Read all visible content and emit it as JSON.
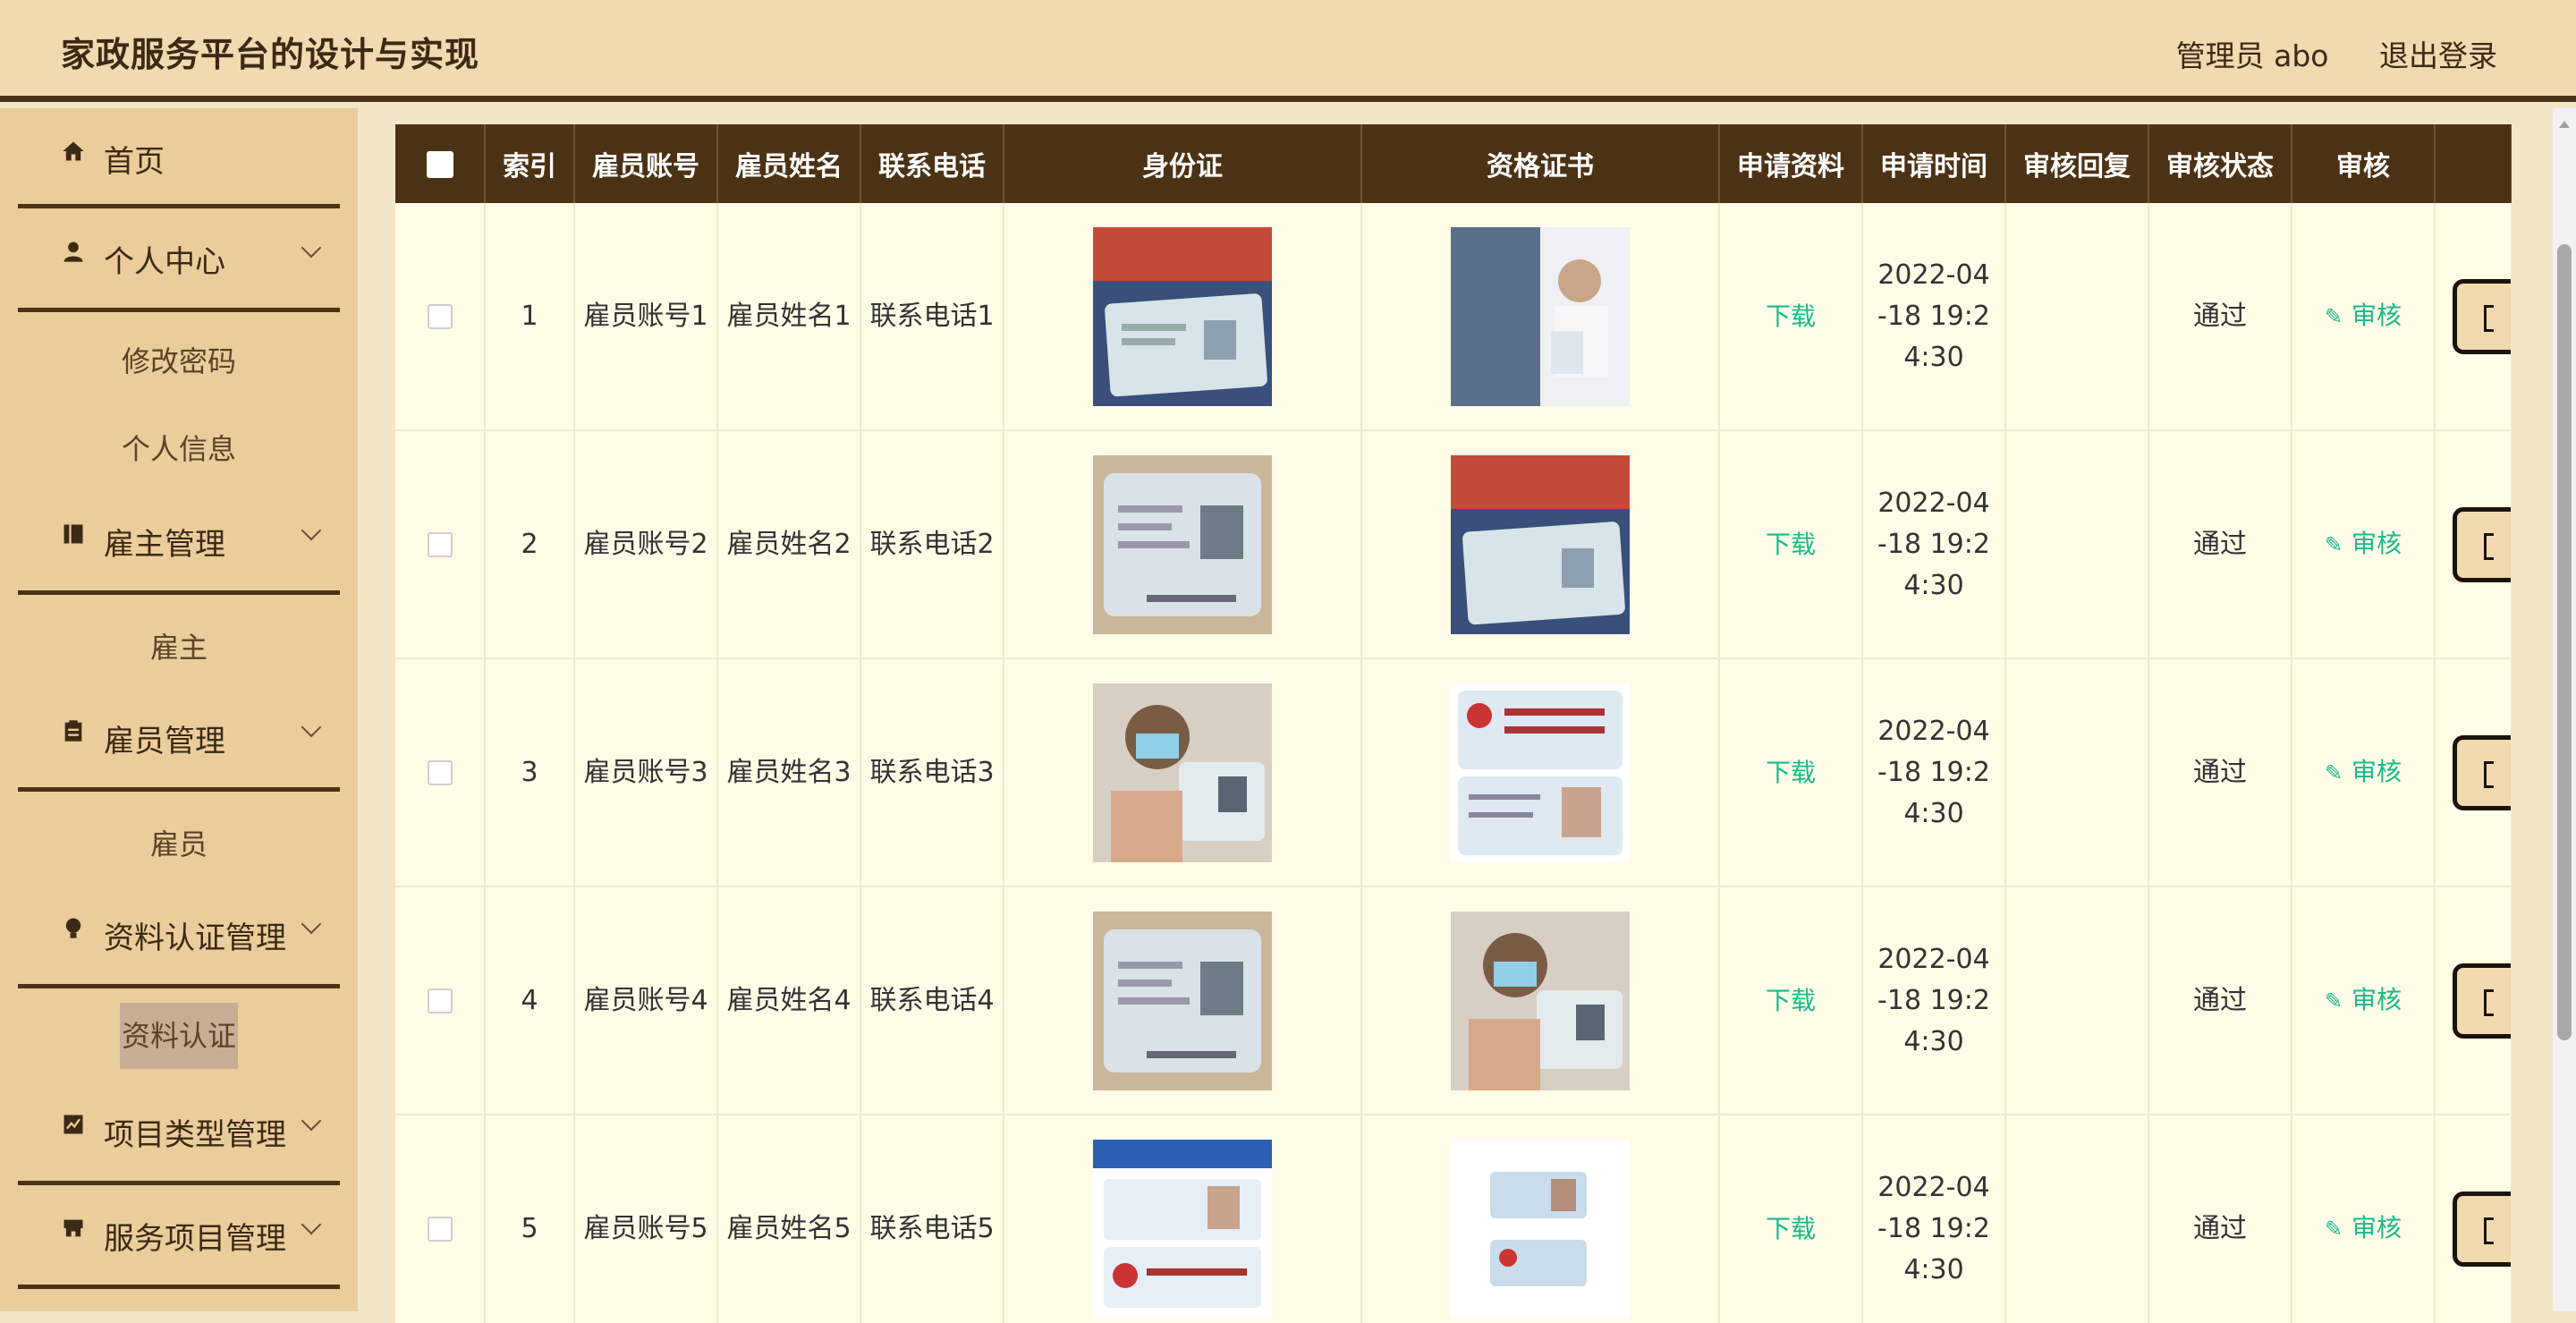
{
  "header": {
    "title": "家政服务平台的设计与实现",
    "user": "管理员 abo",
    "logout": "退出登录"
  },
  "sidebar": {
    "items": [
      {
        "label": "首页",
        "icon": "home-icon"
      },
      {
        "label": "个人中心",
        "icon": "person-icon"
      },
      {
        "label": "雇主管理",
        "icon": "book-icon"
      },
      {
        "label": "雇员管理",
        "icon": "clipboard-icon"
      },
      {
        "label": "资料认证管理",
        "icon": "bulb-icon"
      },
      {
        "label": "项目类型管理",
        "icon": "chart-icon"
      },
      {
        "label": "服务项目管理",
        "icon": "shop-icon"
      }
    ],
    "subitems": {
      "change_password": "修改密码",
      "personal_info": "个人信息",
      "employer": "雇主",
      "employee": "雇员",
      "certification": "资料认证"
    }
  },
  "table": {
    "headers": [
      "索引",
      "雇员账号",
      "雇员姓名",
      "联系电话",
      "身份证",
      "资格证书",
      "申请资料",
      "申请时间",
      "审核回复",
      "审核状态",
      "审核"
    ],
    "rows": [
      {
        "index": "1",
        "account": "雇员账号1",
        "name": "雇员姓名1",
        "phone": "联系电话1",
        "download": "下载",
        "time": "2022-04-18 19:24:30",
        "reply": "",
        "status": "通过",
        "audit": "审核"
      },
      {
        "index": "2",
        "account": "雇员账号2",
        "name": "雇员姓名2",
        "phone": "联系电话2",
        "download": "下载",
        "time": "2022-04-18 19:24:30",
        "reply": "",
        "status": "通过",
        "audit": "审核"
      },
      {
        "index": "3",
        "account": "雇员账号3",
        "name": "雇员姓名3",
        "phone": "联系电话3",
        "download": "下载",
        "time": "2022-04-18 19:24:30",
        "reply": "",
        "status": "通过",
        "audit": "审核"
      },
      {
        "index": "4",
        "account": "雇员账号4",
        "name": "雇员姓名4",
        "phone": "联系电话4",
        "download": "下载",
        "time": "2022-04-18 19:24:30",
        "reply": "",
        "status": "通过",
        "audit": "审核"
      },
      {
        "index": "5",
        "account": "雇员账号5",
        "name": "雇员姓名5",
        "phone": "联系电话5",
        "download": "下载",
        "time": "2022-04-18 19:24:30",
        "reply": "",
        "status": "通过",
        "audit": "审核"
      }
    ]
  },
  "colors": {
    "header_bg": "#f1d9b0",
    "sidebar_bg": "#ebcc9b",
    "table_head_bg": "#4c3215",
    "accent_green": "#19b98d",
    "row_bg": "#fffde8"
  }
}
